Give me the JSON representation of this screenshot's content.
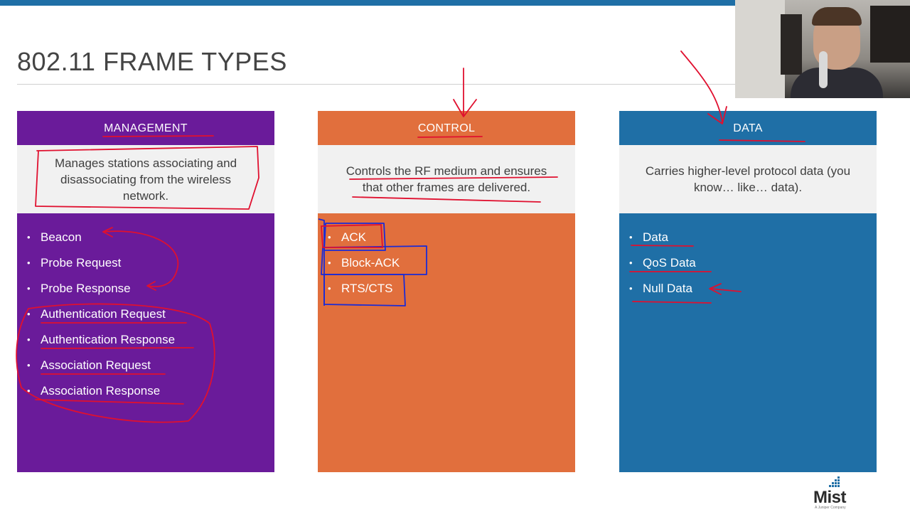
{
  "slide": {
    "title": "802.11 FRAME TYPES",
    "accent_color": "#1f6fa6"
  },
  "cards": {
    "management": {
      "heading": "MANAGEMENT",
      "color": "#6a1b9a",
      "description": "Manages stations associating and disassociating from the wireless network.",
      "items": [
        "Beacon",
        "Probe Request",
        "Probe Response",
        "Authentication Request",
        "Authentication Response",
        "Association Request",
        "Association Response"
      ]
    },
    "control": {
      "heading": "CONTROL",
      "color": "#e16f3d",
      "description": "Controls the RF medium and ensures that other frames are delivered.",
      "items": [
        "ACK",
        "Block-ACK",
        "RTS/CTS"
      ]
    },
    "data": {
      "heading": "DATA",
      "color": "#1f6fa6",
      "description": "Carries higher-level protocol data (you know… like… data).",
      "items": [
        "Data",
        "QoS Data",
        "Null Data"
      ]
    }
  },
  "logo": {
    "name": "Mist",
    "tagline": "A Juniper Company"
  },
  "annotation_color": "#e0102f",
  "annotation_box_color": "#1a2bd6"
}
